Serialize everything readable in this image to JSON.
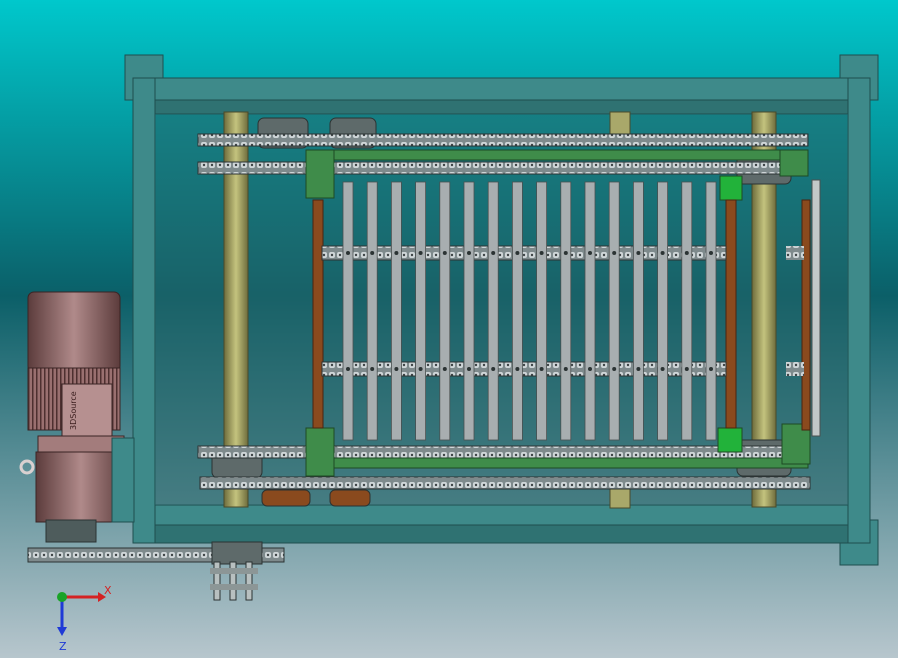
{
  "model_view": {
    "background": {
      "top": "#00c8cc",
      "mid": "#0b5f68",
      "bottom": "#b7c6cd"
    },
    "colors": {
      "frame": "#3e8a8a",
      "frame_dark": "#1f4e4f",
      "slat": "#a8aeb0",
      "chain": "#9aa6a8",
      "shaft": "#a9a86a",
      "arm": "#8a4a1e",
      "bracket": "#3f8c4a",
      "motor": "#a37c7c",
      "sprocket": "#5e6a6a"
    },
    "slat_count": 16,
    "motor_nameplate": "3DSource"
  },
  "triad": {
    "x_label": "X",
    "z_label": "Z",
    "x_color": "#d42222",
    "z_color": "#1f3ad6",
    "origin_color": "#19a327"
  }
}
